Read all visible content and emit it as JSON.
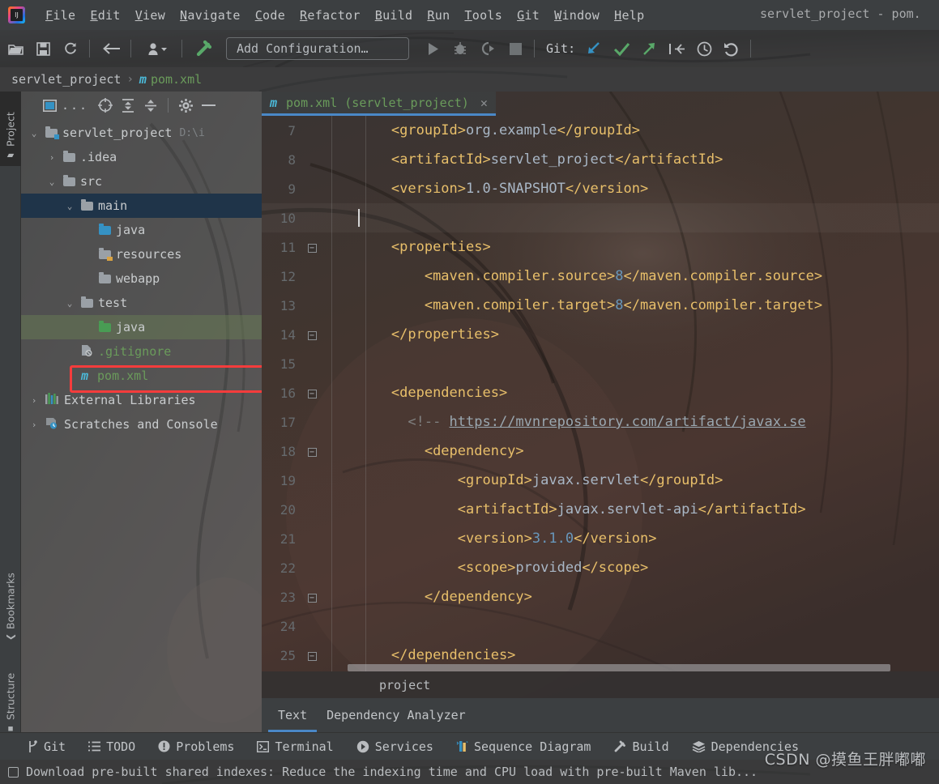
{
  "window": {
    "title": "servlet_project - pom.",
    "logo_icon": "intellij-idea-logo"
  },
  "menubar": {
    "items": [
      {
        "label": "File",
        "mnemonic": "F"
      },
      {
        "label": "Edit",
        "mnemonic": "E"
      },
      {
        "label": "View",
        "mnemonic": "V"
      },
      {
        "label": "Navigate",
        "mnemonic": "N"
      },
      {
        "label": "Code",
        "mnemonic": "C"
      },
      {
        "label": "Refactor",
        "mnemonic": "R"
      },
      {
        "label": "Build",
        "mnemonic": "B"
      },
      {
        "label": "Run",
        "mnemonic": "R"
      },
      {
        "label": "Tools",
        "mnemonic": "T"
      },
      {
        "label": "Git",
        "mnemonic": "G"
      },
      {
        "label": "Window",
        "mnemonic": "W"
      },
      {
        "label": "Help",
        "mnemonic": "H"
      }
    ]
  },
  "toolbar": {
    "open_icon": "open-folder-icon",
    "save_icon": "save-icon",
    "sync_icon": "refresh-icon",
    "back_icon": "arrow-left-icon",
    "profile_icon": "user-icon",
    "profile_dropdown_icon": "chevron-down-icon",
    "build_icon": "hammer-icon",
    "run_config_label": "Add Configuration…",
    "run_icon": "play-icon",
    "debug_icon": "bug-icon",
    "run_coverage_icon": "run-with-coverage-icon",
    "stop_icon": "stop-square-icon",
    "git_label": "Git:",
    "git_update_icon": "update-project-icon",
    "git_commit_icon": "commit-checkmark-icon",
    "git_push_icon": "push-arrow-icon",
    "git_rollback_icon": "branch-merge-icon",
    "git_history_icon": "clock-history-icon",
    "git_revert_icon": "undo-icon"
  },
  "navbar": {
    "project": "servlet_project",
    "separator": "›",
    "file_icon": "maven-m-icon",
    "file": "pom.xml"
  },
  "rail": {
    "tabs": [
      {
        "label": "Project",
        "icon": "project-folder-icon",
        "active": true,
        "top": 0
      },
      {
        "label": "Bookmarks",
        "icon": "bookmark-icon",
        "active": false,
        "top": 0
      },
      {
        "label": "Structure",
        "icon": "structure-icon",
        "active": false,
        "top": 0
      }
    ]
  },
  "project_panel": {
    "toolbar": {
      "view_mode_icon": "window-view-icon",
      "ellipsis": "...",
      "locate_icon": "target-crosshair-icon",
      "expand_all_icon": "expand-all-icon",
      "collapse_all_icon": "collapse-all-icon",
      "settings_icon": "gear-icon",
      "hide_icon": "minimize-icon"
    },
    "tree": [
      {
        "label": "servlet_project",
        "path": "D:\\i",
        "indent": 0,
        "arrow": "expanded",
        "icon": "folder-module",
        "state": "normal",
        "style": "grey"
      },
      {
        "label": ".idea",
        "path": "",
        "indent": 1,
        "arrow": "collapsed",
        "icon": "folder",
        "state": "normal",
        "style": "grey"
      },
      {
        "label": "src",
        "path": "",
        "indent": 1,
        "arrow": "expanded",
        "icon": "folder",
        "state": "normal",
        "style": "grey"
      },
      {
        "label": "main",
        "path": "",
        "indent": 2,
        "arrow": "expanded",
        "icon": "folder",
        "state": "selected",
        "style": "grey"
      },
      {
        "label": "java",
        "path": "",
        "indent": 3,
        "arrow": "none",
        "icon": "folder-source-blue",
        "state": "normal",
        "style": "grey"
      },
      {
        "label": "resources",
        "path": "",
        "indent": 3,
        "arrow": "none",
        "icon": "folder-resources",
        "state": "normal",
        "style": "grey"
      },
      {
        "label": "webapp",
        "path": "",
        "indent": 3,
        "arrow": "none",
        "icon": "folder",
        "state": "highlighted",
        "style": "grey"
      },
      {
        "label": "test",
        "path": "",
        "indent": 2,
        "arrow": "expanded",
        "icon": "folder",
        "state": "normal",
        "style": "grey"
      },
      {
        "label": "java",
        "path": "",
        "indent": 3,
        "arrow": "none",
        "icon": "folder-test-green",
        "state": "green-row",
        "style": "grey"
      },
      {
        "label": ".gitignore",
        "path": "",
        "indent": 2,
        "arrow": "none",
        "icon": "gitignore-file-icon",
        "state": "normal",
        "style": "green"
      },
      {
        "label": "pom.xml",
        "path": "",
        "indent": 2,
        "arrow": "none",
        "icon": "maven-m-icon",
        "state": "normal",
        "style": "green"
      },
      {
        "label": "External Libraries",
        "path": "",
        "indent": 0,
        "arrow": "collapsed",
        "icon": "libraries-icon",
        "state": "normal",
        "style": "grey"
      },
      {
        "label": "Scratches and Console",
        "path": "",
        "indent": 0,
        "arrow": "collapsed",
        "icon": "scratches-icon",
        "state": "normal",
        "style": "grey"
      }
    ],
    "highlight_annotation": "red-rectangle-around-webapp"
  },
  "editor": {
    "tab": {
      "icon": "maven-m-icon",
      "label": "pom.xml (servlet_project)",
      "close_icon": "close-x-icon"
    },
    "first_line_number": 7,
    "lines": [
      {
        "n": 7,
        "indent": 8,
        "fold": "",
        "current": false,
        "parts": [
          {
            "t": "tag",
            "v": "<groupId>"
          },
          {
            "t": "val",
            "v": "org.example"
          },
          {
            "t": "tag",
            "v": "</groupId>"
          }
        ]
      },
      {
        "n": 8,
        "indent": 8,
        "fold": "",
        "current": false,
        "parts": [
          {
            "t": "tag",
            "v": "<artifactId>"
          },
          {
            "t": "val",
            "v": "servlet_project"
          },
          {
            "t": "tag",
            "v": "</artifactId>"
          }
        ]
      },
      {
        "n": 9,
        "indent": 8,
        "fold": "",
        "current": false,
        "parts": [
          {
            "t": "tag",
            "v": "<version>"
          },
          {
            "t": "val",
            "v": "1.0-SNAPSHOT"
          },
          {
            "t": "tag",
            "v": "</version>"
          }
        ]
      },
      {
        "n": 10,
        "indent": 4,
        "fold": "",
        "current": true,
        "parts": [
          {
            "t": "caret",
            "v": ""
          }
        ]
      },
      {
        "n": 11,
        "indent": 8,
        "fold": "-",
        "current": false,
        "parts": [
          {
            "t": "tag",
            "v": "<properties>"
          }
        ]
      },
      {
        "n": 12,
        "indent": 12,
        "fold": "",
        "current": false,
        "parts": [
          {
            "t": "tag",
            "v": "<maven.compiler.source>"
          },
          {
            "t": "num",
            "v": "8"
          },
          {
            "t": "tag",
            "v": "</maven.compiler.source>"
          }
        ]
      },
      {
        "n": 13,
        "indent": 12,
        "fold": "",
        "current": false,
        "parts": [
          {
            "t": "tag",
            "v": "<maven.compiler.target>"
          },
          {
            "t": "num",
            "v": "8"
          },
          {
            "t": "tag",
            "v": "</maven.compiler.target>"
          }
        ]
      },
      {
        "n": 14,
        "indent": 8,
        "fold": "-",
        "current": false,
        "parts": [
          {
            "t": "tag",
            "v": "</properties>"
          }
        ]
      },
      {
        "n": 15,
        "indent": 8,
        "fold": "",
        "current": false,
        "parts": []
      },
      {
        "n": 16,
        "indent": 8,
        "fold": "-",
        "current": false,
        "parts": [
          {
            "t": "tag",
            "v": "<dependencies>"
          }
        ]
      },
      {
        "n": 17,
        "indent": 10,
        "fold": "",
        "current": false,
        "parts": [
          {
            "t": "cmt",
            "v": "<!-- "
          },
          {
            "t": "link",
            "v": "https://mvnrepository.com/artifact/javax.se"
          }
        ]
      },
      {
        "n": 18,
        "indent": 12,
        "fold": "-",
        "current": false,
        "parts": [
          {
            "t": "tag",
            "v": "<dependency>"
          }
        ]
      },
      {
        "n": 19,
        "indent": 16,
        "fold": "",
        "current": false,
        "parts": [
          {
            "t": "tag",
            "v": "<groupId>"
          },
          {
            "t": "val",
            "v": "javax.servlet"
          },
          {
            "t": "tag",
            "v": "</groupId>"
          }
        ]
      },
      {
        "n": 20,
        "indent": 16,
        "fold": "",
        "current": false,
        "parts": [
          {
            "t": "tag",
            "v": "<artifactId>"
          },
          {
            "t": "val",
            "v": "javax.servlet-api"
          },
          {
            "t": "tag",
            "v": "</artifactId>"
          }
        ]
      },
      {
        "n": 21,
        "indent": 16,
        "fold": "",
        "current": false,
        "parts": [
          {
            "t": "tag",
            "v": "<version>"
          },
          {
            "t": "num",
            "v": "3.1.0"
          },
          {
            "t": "tag",
            "v": "</version>"
          }
        ]
      },
      {
        "n": 22,
        "indent": 16,
        "fold": "",
        "current": false,
        "parts": [
          {
            "t": "tag",
            "v": "<scope>"
          },
          {
            "t": "val",
            "v": "provided"
          },
          {
            "t": "tag",
            "v": "</scope>"
          }
        ]
      },
      {
        "n": 23,
        "indent": 12,
        "fold": "-",
        "current": false,
        "parts": [
          {
            "t": "tag",
            "v": "</dependency>"
          }
        ]
      },
      {
        "n": 24,
        "indent": 12,
        "fold": "",
        "current": false,
        "parts": []
      },
      {
        "n": 25,
        "indent": 8,
        "fold": "-",
        "current": false,
        "parts": [
          {
            "t": "tag",
            "v": "</dependencies>"
          }
        ]
      }
    ],
    "breadcrumb": "project",
    "bottom_tabs": [
      {
        "label": "Text",
        "active": true
      },
      {
        "label": "Dependency Analyzer",
        "active": false
      }
    ]
  },
  "toolwindow_bar": {
    "items": [
      {
        "label": "Git",
        "icon": "git-branch-icon"
      },
      {
        "label": "TODO",
        "icon": "todo-list-icon"
      },
      {
        "label": "Problems",
        "icon": "problems-warning-icon"
      },
      {
        "label": "Terminal",
        "icon": "terminal-icon"
      },
      {
        "label": "Services",
        "icon": "services-play-icon"
      },
      {
        "label": "Sequence Diagram",
        "icon": "sequence-diagram-icon"
      },
      {
        "label": "Build",
        "icon": "hammer-icon"
      },
      {
        "label": "Dependencies",
        "icon": "layers-icon"
      }
    ]
  },
  "statusbar": {
    "icon": "notification-square-icon",
    "message": "Download pre-built shared indexes: Reduce the indexing time and CPU load with pre-built Maven lib..."
  },
  "watermark": {
    "text": "CSDN @摸鱼王胖嘟嘟"
  },
  "colors": {
    "accent_blue": "#4a88c7",
    "tag_orange": "#e8bf6a",
    "value_grey_blue": "#a9b7c6",
    "number_blue": "#6897bb",
    "string_green": "#6a9b5b",
    "highlight_red": "#f63c3c",
    "selection_blue": "#1f3449"
  }
}
